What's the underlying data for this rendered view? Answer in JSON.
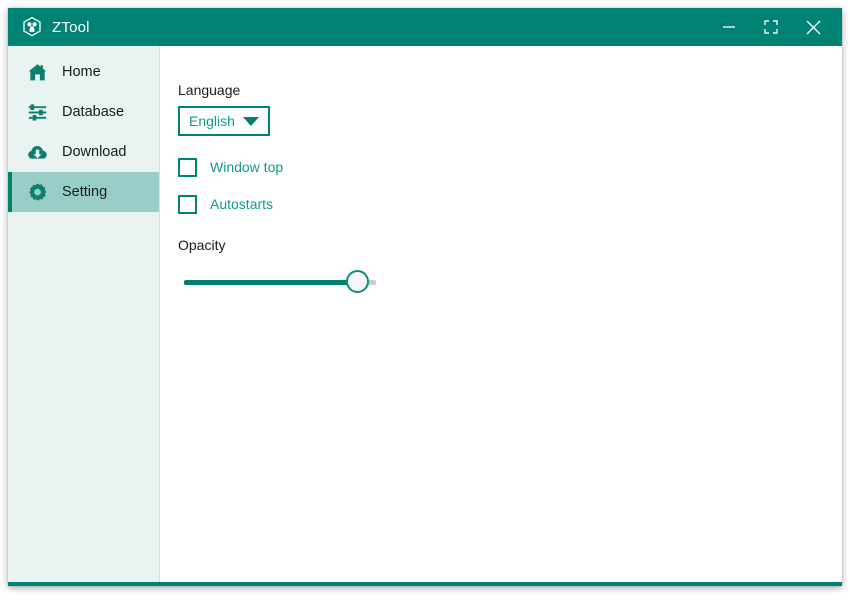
{
  "window": {
    "title": "ZTool",
    "app_icon": "hexagon-trefoil-icon",
    "controls": {
      "minimize": "minimize-icon",
      "maximize": "maximize-icon",
      "close": "close-icon"
    }
  },
  "sidebar": {
    "items": [
      {
        "id": "home",
        "label": "Home",
        "icon": "home-icon",
        "active": false
      },
      {
        "id": "database",
        "label": "Database",
        "icon": "sliders-icon",
        "active": false
      },
      {
        "id": "download",
        "label": "Download",
        "icon": "cloud-download-icon",
        "active": false
      },
      {
        "id": "setting",
        "label": "Setting",
        "icon": "gear-icon",
        "active": true
      }
    ]
  },
  "settings": {
    "language": {
      "label": "Language",
      "value": "English",
      "options": [
        "English"
      ]
    },
    "window_top": {
      "label": "Window top",
      "checked": false
    },
    "autostarts": {
      "label": "Autostarts",
      "checked": false
    },
    "opacity": {
      "label": "Opacity",
      "value": 88
    }
  },
  "colors": {
    "accent": "#008375",
    "accent_text": "#13988a",
    "sidebar_bg": "#e9f3f1",
    "sidebar_active": "#99cec8",
    "text": "#1b1b1b"
  }
}
